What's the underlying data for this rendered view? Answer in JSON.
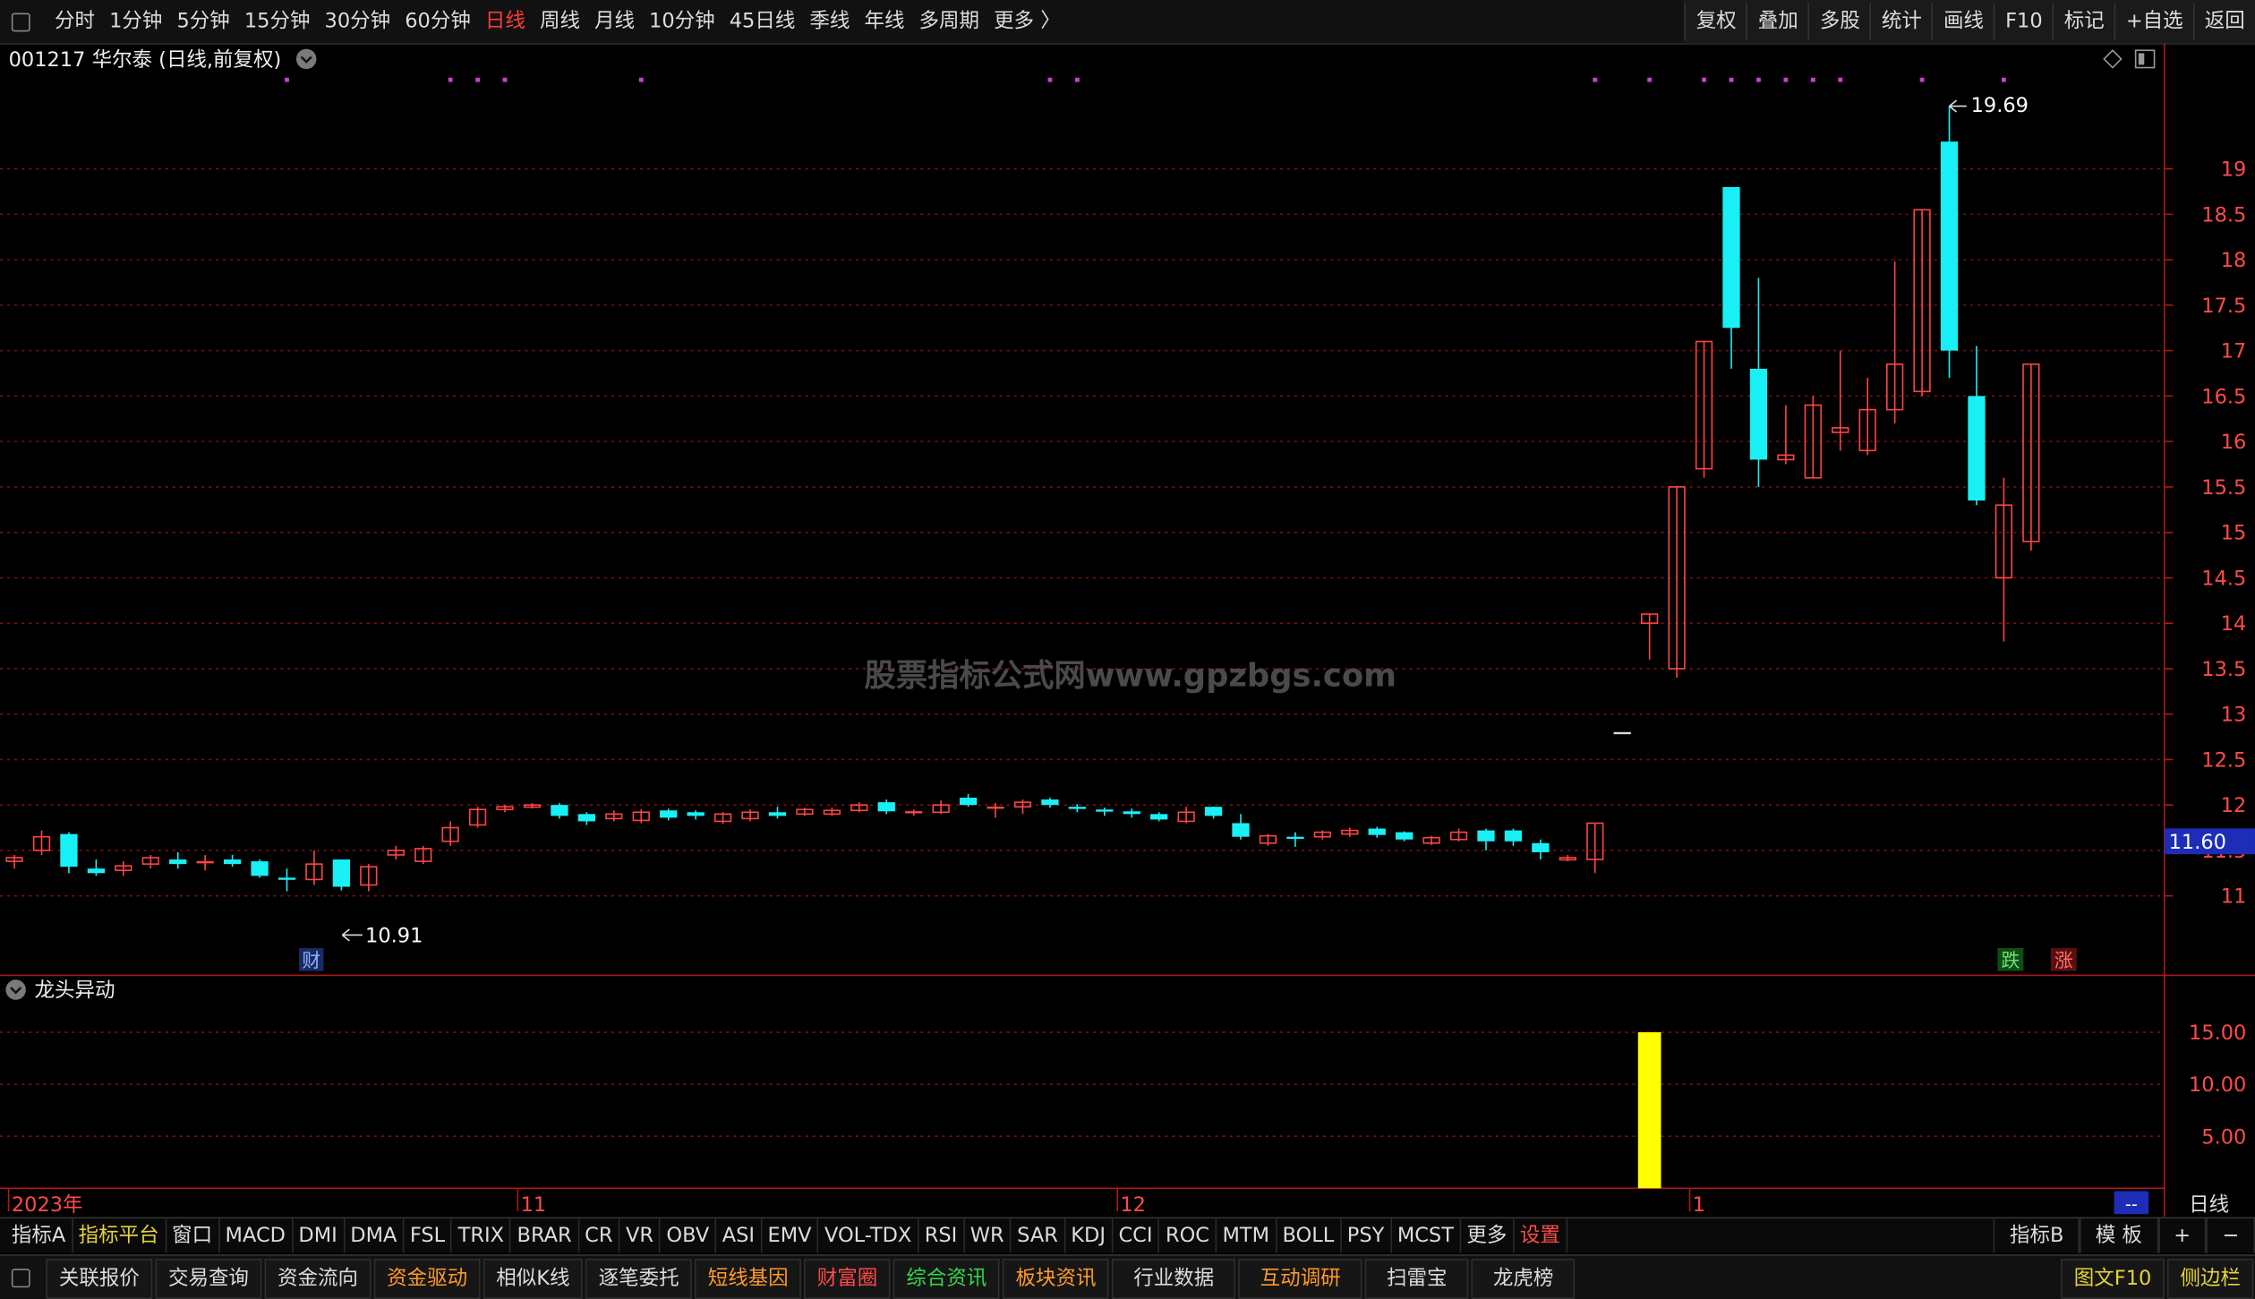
{
  "topbar": {
    "periods": [
      "分时",
      "1分钟",
      "5分钟",
      "15分钟",
      "30分钟",
      "60分钟",
      "日线",
      "周线",
      "月线",
      "10分钟",
      "45日线",
      "季线",
      "年线",
      "多周期",
      "更多 〉"
    ],
    "active_index": 6,
    "right_buttons": [
      "复权",
      "叠加",
      "多股",
      "统计",
      "画线",
      "F10",
      "标记",
      "+自选",
      "返回"
    ]
  },
  "chart": {
    "title": "001217 华尔泰 (日线,前复权)",
    "watermark": "股票指标公式网www.gpzbgs.com",
    "last_price_label": "11.60",
    "right_panel_label": "日线",
    "high_label": "19.69",
    "low_label": "10.91",
    "cai_badge": "财",
    "die_badge": "跌",
    "zhang_badge": "涨",
    "x_labels": [
      {
        "text": "2023年",
        "index": 0
      },
      {
        "text": "11",
        "index": 19
      },
      {
        "text": "12",
        "index": 41
      },
      {
        "text": "1",
        "index": 62
      }
    ],
    "corner_dash": "--",
    "colors": {
      "up": "#ff4444",
      "down": "#19f0f6",
      "grid": "#7a0f0f",
      "marker": "#d23cd2",
      "volume": "#ffff00"
    }
  },
  "subchart": {
    "title": "龙头异动",
    "y_ticks": [
      "15.00",
      "10.00",
      "5.00"
    ]
  },
  "indicator_tabs": [
    "指标A",
    "指标平台",
    "窗口",
    "MACD",
    "DMI",
    "DMA",
    "FSL",
    "TRIX",
    "BRAR",
    "CR",
    "VR",
    "OBV",
    "ASI",
    "EMV",
    "VOL-TDX",
    "RSI",
    "WR",
    "SAR",
    "KDJ",
    "CCI",
    "ROC",
    "MTM",
    "BOLL",
    "PSY",
    "MCST",
    "更多",
    "设置"
  ],
  "indicator_right": [
    "指标B",
    "模 板",
    "+",
    "−"
  ],
  "bottom_tabs": [
    "关联报价",
    "交易查询",
    "资金流向",
    "资金驱动",
    "相似K线",
    "逐笔委托",
    "短线基因",
    "财富圈",
    "综合资讯",
    "板块资讯",
    "行业数据",
    "互动调研",
    "扫雷宝",
    "龙虎榜"
  ],
  "bottom_right": [
    "图文F10",
    "侧边栏"
  ],
  "chart_data": {
    "type": "candlestick",
    "y_ticks": [
      19.0,
      18.5,
      18.0,
      17.5,
      17.0,
      16.5,
      16.0,
      15.5,
      15.0,
      14.5,
      14.0,
      13.5,
      13.0,
      12.5,
      12.0,
      11.5,
      11.0
    ],
    "ylim": [
      10.6,
      19.75
    ],
    "ohlc": [
      [
        11.38,
        11.45,
        11.3,
        11.42
      ],
      [
        11.5,
        11.72,
        11.45,
        11.65
      ],
      [
        11.68,
        11.7,
        11.25,
        11.32
      ],
      [
        11.3,
        11.4,
        11.22,
        11.25
      ],
      [
        11.28,
        11.38,
        11.22,
        11.33
      ],
      [
        11.35,
        11.45,
        11.3,
        11.42
      ],
      [
        11.4,
        11.48,
        11.3,
        11.35
      ],
      [
        11.37,
        11.45,
        11.28,
        11.37
      ],
      [
        11.4,
        11.45,
        11.32,
        11.35
      ],
      [
        11.38,
        11.4,
        11.2,
        11.22
      ],
      [
        11.2,
        11.3,
        11.05,
        11.18
      ],
      [
        11.18,
        11.5,
        11.12,
        11.35
      ],
      [
        11.4,
        11.4,
        11.06,
        11.1
      ],
      [
        11.12,
        11.35,
        11.05,
        11.32
      ],
      [
        11.45,
        11.55,
        11.4,
        11.5
      ],
      [
        11.38,
        11.55,
        11.35,
        11.52
      ],
      [
        11.6,
        11.82,
        11.55,
        11.75
      ],
      [
        11.78,
        11.98,
        11.75,
        11.95
      ],
      [
        11.95,
        12.0,
        11.92,
        11.98
      ],
      [
        11.98,
        12.02,
        11.96,
        12.0
      ],
      [
        12.0,
        12.02,
        11.85,
        11.88
      ],
      [
        11.9,
        11.92,
        11.78,
        11.82
      ],
      [
        11.85,
        11.94,
        11.82,
        11.9
      ],
      [
        11.83,
        11.95,
        11.8,
        11.92
      ],
      [
        11.94,
        11.96,
        11.83,
        11.86
      ],
      [
        11.92,
        11.94,
        11.84,
        11.88
      ],
      [
        11.82,
        11.92,
        11.79,
        11.9
      ],
      [
        11.85,
        11.95,
        11.82,
        11.92
      ],
      [
        11.92,
        11.98,
        11.85,
        11.88
      ],
      [
        11.9,
        11.97,
        11.88,
        11.95
      ],
      [
        11.9,
        11.97,
        11.88,
        11.94
      ],
      [
        11.94,
        12.03,
        11.92,
        12.0
      ],
      [
        12.03,
        12.06,
        11.9,
        11.93
      ],
      [
        11.92,
        11.95,
        11.88,
        11.92
      ],
      [
        11.92,
        12.05,
        11.9,
        12.0
      ],
      [
        12.08,
        12.12,
        11.98,
        12.0
      ],
      [
        11.97,
        12.02,
        11.86,
        11.97
      ],
      [
        11.98,
        12.06,
        11.9,
        12.03
      ],
      [
        12.06,
        12.08,
        11.97,
        12.0
      ],
      [
        11.98,
        12.01,
        11.92,
        11.96
      ],
      [
        11.95,
        11.97,
        11.88,
        11.93
      ],
      [
        11.93,
        11.96,
        11.86,
        11.9
      ],
      [
        11.9,
        11.92,
        11.82,
        11.84
      ],
      [
        11.82,
        11.98,
        11.8,
        11.92
      ],
      [
        11.98,
        11.98,
        11.85,
        11.88
      ],
      [
        11.8,
        11.9,
        11.62,
        11.65
      ],
      [
        11.58,
        11.68,
        11.55,
        11.66
      ],
      [
        11.65,
        11.7,
        11.54,
        11.64
      ],
      [
        11.65,
        11.72,
        11.62,
        11.7
      ],
      [
        11.68,
        11.75,
        11.65,
        11.72
      ],
      [
        11.74,
        11.76,
        11.64,
        11.67
      ],
      [
        11.7,
        11.71,
        11.6,
        11.62
      ],
      [
        11.58,
        11.66,
        11.56,
        11.64
      ],
      [
        11.62,
        11.74,
        11.6,
        11.7
      ],
      [
        11.72,
        11.74,
        11.5,
        11.6
      ],
      [
        11.72,
        11.74,
        11.55,
        11.6
      ],
      [
        11.58,
        11.62,
        11.4,
        11.48
      ],
      [
        11.4,
        11.45,
        11.38,
        11.42
      ],
      [
        11.4,
        11.8,
        11.25,
        11.8
      ],
      [
        12.79,
        12.79,
        12.79,
        12.79
      ],
      [
        14.0,
        14.1,
        13.6,
        14.1
      ],
      [
        13.5,
        15.5,
        13.4,
        15.5
      ],
      [
        15.7,
        17.1,
        15.6,
        17.1
      ],
      [
        18.8,
        18.8,
        16.8,
        17.25
      ],
      [
        16.8,
        17.8,
        15.5,
        15.8
      ],
      [
        15.8,
        16.4,
        15.75,
        15.85
      ],
      [
        15.6,
        16.5,
        15.6,
        16.4
      ],
      [
        16.1,
        17.0,
        15.9,
        16.15
      ],
      [
        15.9,
        16.7,
        15.85,
        16.35
      ],
      [
        16.35,
        17.98,
        16.2,
        16.85
      ],
      [
        16.55,
        18.55,
        16.5,
        18.55
      ],
      [
        19.3,
        19.69,
        16.7,
        17.0
      ],
      [
        16.5,
        17.05,
        15.3,
        15.35
      ],
      [
        14.5,
        15.6,
        13.8,
        15.3
      ],
      [
        14.9,
        16.85,
        14.8,
        16.85
      ]
    ],
    "volume": [
      {
        "index": 60,
        "value": 15.0
      }
    ],
    "volume_ylim": [
      0,
      16.6
    ],
    "top_marker_indices": [
      10,
      16,
      17,
      18,
      23,
      38,
      39,
      58,
      60,
      62,
      63,
      64,
      65,
      66,
      67,
      70,
      73
    ],
    "price_line": 11.6
  }
}
